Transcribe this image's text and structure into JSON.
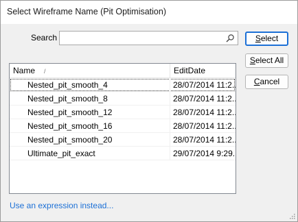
{
  "window": {
    "title": "Select Wireframe Name (Pit Optimisation)"
  },
  "search": {
    "label": "Search",
    "value": "",
    "placeholder": ""
  },
  "buttons": {
    "select": {
      "accel": "S",
      "rest": "elect"
    },
    "select_all": {
      "accel": "S",
      "rest": "elect All"
    },
    "cancel": {
      "accel": "C",
      "rest": "ancel"
    }
  },
  "table": {
    "columns": {
      "name": "Name",
      "date": "EditDate"
    },
    "sort_glyph": "/",
    "rows": [
      {
        "name": "Nested_pit_smooth_4",
        "date": "28/07/2014 11:2..."
      },
      {
        "name": "Nested_pit_smooth_8",
        "date": "28/07/2014 11:2..."
      },
      {
        "name": "Nested_pit_smooth_12",
        "date": "28/07/2014 11:2..."
      },
      {
        "name": "Nested_pit_smooth_16",
        "date": "28/07/2014 11:2..."
      },
      {
        "name": "Nested_pit_smooth_20",
        "date": "28/07/2014 11:2..."
      },
      {
        "name": "Ultimate_pit_exact",
        "date": "29/07/2014 9:29..."
      }
    ],
    "selected_index": 0
  },
  "expression_link": "Use an expression instead...",
  "colors": {
    "accent": "#1a6fd6",
    "link": "#1a6fd6",
    "border": "#828790"
  },
  "icons": {
    "search": "search-icon",
    "grip": "resize-grip-icon"
  }
}
